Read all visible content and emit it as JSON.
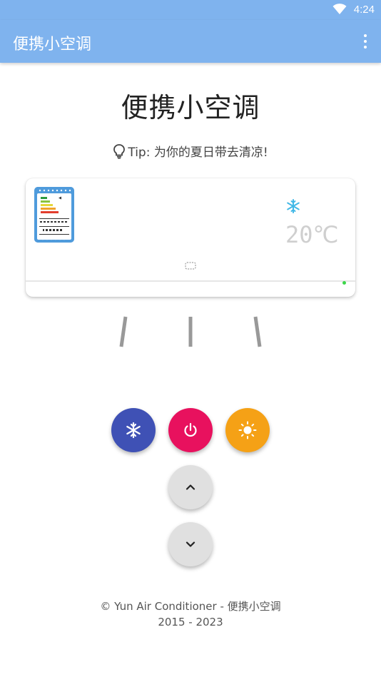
{
  "status_bar": {
    "time": "4:24",
    "wifi_icon": "wifi-icon"
  },
  "app_bar": {
    "title": "便携小空调",
    "menu_icon": "more-vert-icon"
  },
  "main": {
    "title": "便携小空调",
    "tip": "Tip: 为你的夏日带去清凉!",
    "tip_icon": "lightbulb-icon"
  },
  "ac_unit": {
    "temperature": "20℃",
    "mode_icon": "snowflake-icon",
    "led_color": "#3cd64a"
  },
  "controls": {
    "cool_icon": "snowflake-icon",
    "power_icon": "power-icon",
    "heat_icon": "sun-icon",
    "up_icon": "chevron-up-icon",
    "down_icon": "chevron-down-icon",
    "colors": {
      "cool": "#3f51b5",
      "power": "#e8115e",
      "heat": "#f5a116",
      "neutral": "#e0e0e0",
      "app_bar": "#7fb3ee"
    }
  },
  "footer": {
    "line1": "© Yun Air Conditioner - 便携小空调",
    "line2": "2015 - 2023"
  }
}
